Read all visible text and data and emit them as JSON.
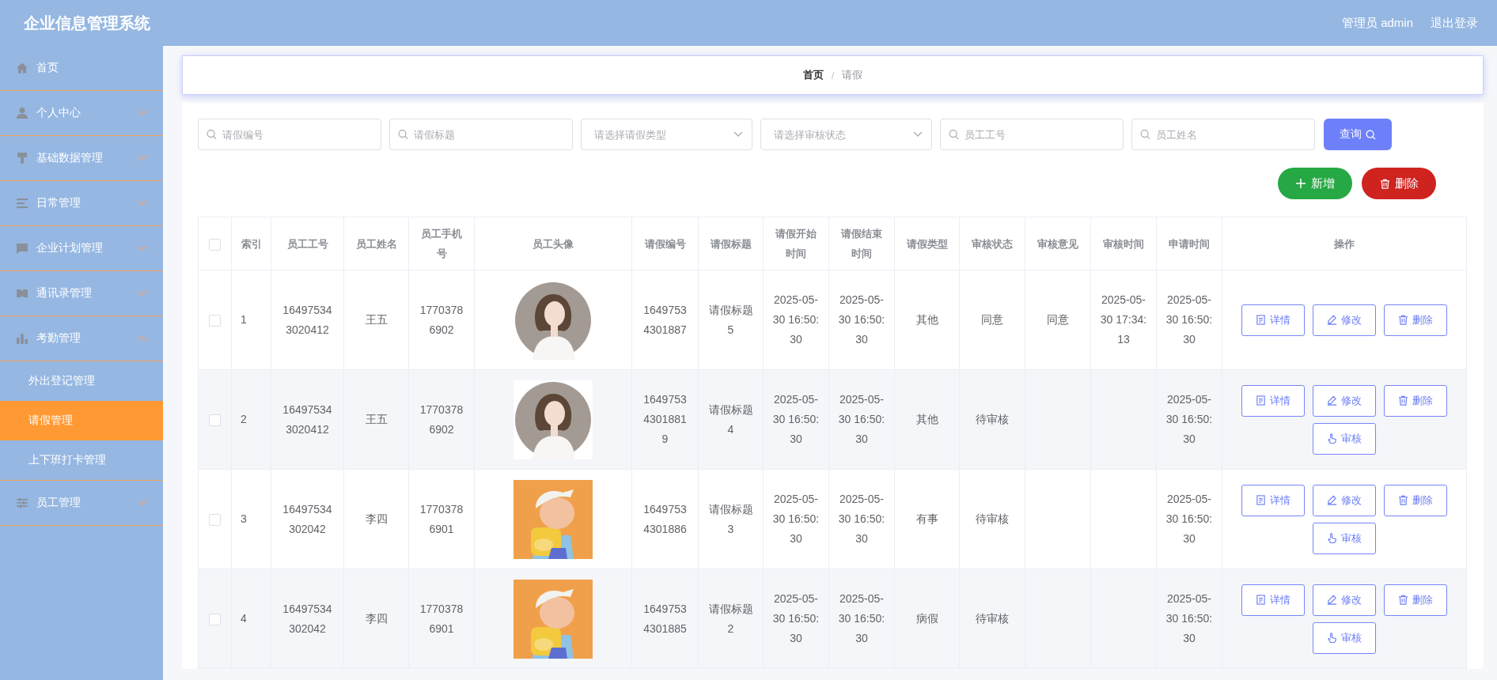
{
  "app_title": "企业信息管理系统",
  "header": {
    "user": "管理员 admin",
    "logout": "退出登录"
  },
  "sidebar": {
    "items": [
      {
        "label": "首页",
        "kind": "link"
      },
      {
        "label": "个人中心",
        "kind": "group",
        "expanded": false
      },
      {
        "label": "基础数据管理",
        "kind": "group",
        "expanded": false
      },
      {
        "label": "日常管理",
        "kind": "group",
        "expanded": false
      },
      {
        "label": "企业计划管理",
        "kind": "group",
        "expanded": false
      },
      {
        "label": "通讯录管理",
        "kind": "group",
        "expanded": false
      },
      {
        "label": "考勤管理",
        "kind": "group",
        "expanded": true,
        "children": [
          {
            "label": "外出登记管理",
            "selected": false
          },
          {
            "label": "请假管理",
            "selected": true
          },
          {
            "label": "上下班打卡管理",
            "selected": false
          }
        ]
      },
      {
        "label": "员工管理",
        "kind": "group",
        "expanded": false
      }
    ]
  },
  "breadcrumb": [
    "首页",
    "请假"
  ],
  "breadcrumb_separator": "/",
  "filters": [
    {
      "kind": "search",
      "placeholder": "请假编号"
    },
    {
      "kind": "search",
      "placeholder": "请假标题"
    },
    {
      "kind": "select",
      "placeholder": "请选择请假类型"
    },
    {
      "kind": "select",
      "placeholder": "请选择审核状态"
    },
    {
      "kind": "search",
      "placeholder": "员工工号"
    },
    {
      "kind": "search",
      "placeholder": "员工姓名"
    }
  ],
  "query_button": "查询",
  "add_button": "新增",
  "delete_button": "删除",
  "table": {
    "header_checked": false,
    "columns": [
      {
        "kind": "text",
        "title": "索引"
      },
      {
        "kind": "text",
        "title": "员工工号"
      },
      {
        "kind": "text",
        "title": "员工姓名"
      },
      {
        "kind": "text",
        "title": "员工手机号"
      },
      {
        "kind": "picture",
        "title": "员工头像"
      },
      {
        "kind": "text",
        "title": "请假编号"
      },
      {
        "kind": "text",
        "title": "请假标题"
      },
      {
        "kind": "text",
        "title": "请假开始时间"
      },
      {
        "kind": "text",
        "title": "请假结束时间"
      },
      {
        "kind": "text",
        "title": "请假类型"
      },
      {
        "kind": "text",
        "title": "审核状态"
      },
      {
        "kind": "text",
        "title": "审核意见"
      },
      {
        "kind": "text",
        "title": "审核时间"
      },
      {
        "kind": "text",
        "title": "申请时间"
      },
      {
        "kind": "actions",
        "title": "操作"
      }
    ],
    "rows": [
      {
        "checked": false,
        "cells": [
          "1",
          "164975343020412",
          "王五",
          "17703786902",
          {
            "kind": "picture"
          },
          "16497534301887",
          "请假标题5",
          "2025-05-30 16:50:30",
          "2025-05-30 16:50:30",
          "其他",
          "同意",
          "同意",
          "2025-05-30 17:34:13",
          "2025-05-30 16:50:30"
        ],
        "actions": [
          {
            "kind": "detail",
            "label": "详情"
          },
          {
            "kind": "edit",
            "label": "修改"
          },
          {
            "kind": "delete",
            "label": "删除"
          }
        ]
      },
      {
        "checked": false,
        "cells": [
          "2",
          "164975343020412",
          "王五",
          "17703786902",
          {
            "kind": "picture"
          },
          "164975343018819",
          "请假标题4",
          "2025-05-30 16:50:30",
          "2025-05-30 16:50:30",
          "其他",
          "待审核",
          "",
          "",
          "2025-05-30 16:50:30"
        ],
        "actions": [
          {
            "kind": "detail",
            "label": "详情"
          },
          {
            "kind": "edit",
            "label": "修改"
          },
          {
            "kind": "delete",
            "label": "删除"
          },
          {
            "kind": "review",
            "label": "审核"
          }
        ]
      },
      {
        "checked": false,
        "cells": [
          "3",
          "16497534302042",
          "李四",
          "17703786901",
          {
            "kind": "picture"
          },
          "16497534301886",
          "请假标题3",
          "2025-05-30 16:50:30",
          "2025-05-30 16:50:30",
          "有事",
          "待审核",
          "",
          "",
          "2025-05-30 16:50:30"
        ],
        "actions": [
          {
            "kind": "detail",
            "label": "详情"
          },
          {
            "kind": "edit",
            "label": "修改"
          },
          {
            "kind": "delete",
            "label": "删除"
          },
          {
            "kind": "review",
            "label": "审核"
          }
        ]
      },
      {
        "checked": false,
        "cells": [
          "4",
          "16497534302042",
          "李四",
          "17703786901",
          {
            "kind": "picture"
          },
          "16497534301885",
          "请假标题2",
          "2025-05-30 16:50:30",
          "2025-05-30 16:50:30",
          "病假",
          "待审核",
          "",
          "",
          "2025-05-30 16:50:30"
        ],
        "actions": [
          {
            "kind": "detail",
            "label": "详情"
          },
          {
            "kind": "edit",
            "label": "修改"
          },
          {
            "kind": "delete",
            "label": "删除"
          },
          {
            "kind": "review",
            "label": "审核"
          }
        ]
      }
    ]
  }
}
